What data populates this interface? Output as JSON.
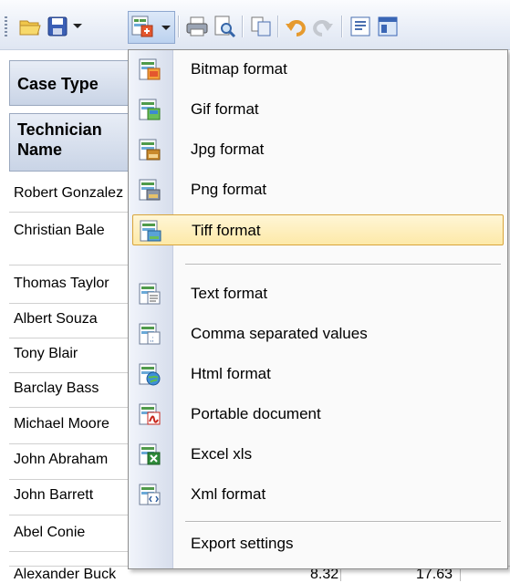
{
  "toolbar": {
    "buttons": [
      {
        "name": "open-folder-icon"
      },
      {
        "name": "save-icon"
      },
      {
        "name": "export-icon"
      },
      {
        "name": "print-icon"
      },
      {
        "name": "print-preview-icon"
      },
      {
        "name": "copy-icon"
      },
      {
        "name": "undo-icon"
      },
      {
        "name": "redo-icon"
      },
      {
        "name": "page-setup-icon"
      }
    ]
  },
  "grid": {
    "header_case_type": "Case Type",
    "header_technician": "Technician Name",
    "rows": [
      "Robert Gonzalez",
      "Christian Bale",
      "Thomas Taylor",
      "Albert Souza",
      "Tony Blair",
      "Barclay Bass",
      "Michael Moore",
      "John Abraham",
      "John Barrett",
      "Abel Conie",
      "Alexander Buck"
    ],
    "last_row_values": [
      "8.32",
      "17.63"
    ]
  },
  "export_menu": {
    "items": [
      {
        "label": "Bitmap format",
        "icon": "bitmap-icon"
      },
      {
        "label": "Gif format",
        "icon": "gif-icon"
      },
      {
        "label": "Jpg format",
        "icon": "jpg-icon"
      },
      {
        "label": "Png format",
        "icon": "png-icon"
      },
      {
        "label": "Tiff format",
        "icon": "tiff-icon",
        "selected": true
      },
      {
        "label": "Text format",
        "icon": "text-icon"
      },
      {
        "label": "Comma separated values",
        "icon": "csv-icon"
      },
      {
        "label": "Html format",
        "icon": "html-icon"
      },
      {
        "label": "Portable document",
        "icon": "pdf-icon"
      },
      {
        "label": "Excel xls",
        "icon": "excel-icon"
      },
      {
        "label": "Xml format",
        "icon": "xml-icon"
      },
      {
        "label": "Export settings",
        "icon": ""
      }
    ]
  },
  "colors": {
    "selection_border": "#d8a43a",
    "selection_fill": "#fde9a8",
    "header_fill": "#c9d4e6"
  }
}
